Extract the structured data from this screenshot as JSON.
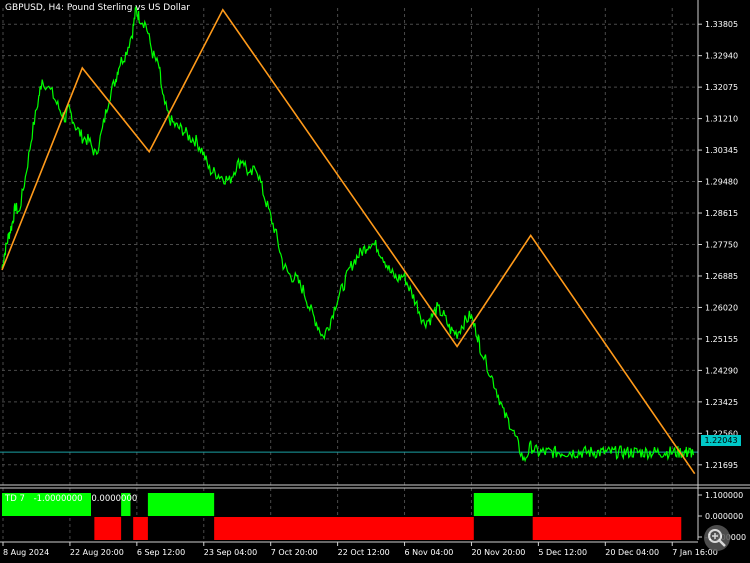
{
  "header": {
    "title": "GBPUSD, H4:  Pound Sterling vs US Dollar"
  },
  "current_price": "1.22043",
  "indicator": {
    "name": "TD 7",
    "value1": "-1.0000000",
    "value2": "0.0000000",
    "scale": [
      "1.100000",
      "0.000000",
      "-1.100000"
    ]
  },
  "colors": {
    "background": "#000000",
    "grid": "#4a4a4a",
    "price": "#00ff00",
    "zigzag": "#ff9a1a",
    "bid_line": "#1a9fa3",
    "bull": "#00ff00",
    "bear": "#ff0000"
  },
  "chart_data": {
    "type": "line",
    "symbol": "GBPUSD",
    "timeframe": "H4",
    "y_ticks": [
      "1.33805",
      "1.32940",
      "1.32075",
      "1.31210",
      "1.30345",
      "1.29480",
      "1.28615",
      "1.27750",
      "1.26885",
      "1.26020",
      "1.25155",
      "1.24290",
      "1.23425",
      "1.22560",
      "1.21695"
    ],
    "ylim": [
      1.2125,
      1.3425
    ],
    "x_ticks": [
      "8 Aug 2024",
      "22 Aug 20:00",
      "6 Sep 12:00",
      "23 Sep 04:00",
      "7 Oct 20:00",
      "22 Oct 12:00",
      "6 Nov 04:00",
      "20 Nov 20:00",
      "5 Dec 12:00",
      "20 Dec 04:00",
      "7 Jan 16:00"
    ],
    "price_series": {
      "name": "GBPUSD",
      "x": [
        0,
        0.05,
        0.1,
        0.15,
        0.2,
        0.25,
        0.35,
        0.45,
        0.55,
        0.6,
        0.75,
        0.85,
        0.95,
        1.0,
        1.1,
        1.2,
        1.3,
        1.4,
        1.5,
        1.6,
        1.7,
        1.75,
        1.85,
        1.95,
        2.0,
        2.05,
        2.15,
        2.25,
        2.35,
        2.4,
        2.5,
        2.6,
        2.7,
        2.8,
        2.9,
        3.0,
        3.1,
        3.2,
        3.3,
        3.4,
        3.5,
        3.6,
        3.7,
        3.8,
        3.9,
        4.0,
        4.1,
        4.2,
        4.3,
        4.4,
        4.5,
        4.6,
        4.7,
        4.8,
        4.9,
        5.0,
        5.1,
        5.2,
        5.3,
        5.4,
        5.5,
        5.6,
        5.7,
        5.8,
        5.9,
        6.0,
        6.1,
        6.2,
        6.3,
        6.4,
        6.5,
        6.6,
        6.7,
        6.8,
        6.9,
        7.0,
        7.1,
        7.15,
        7.3,
        7.4,
        7.5,
        7.6,
        7.7,
        7.8,
        7.9,
        8.0,
        8.1,
        8.2,
        8.3,
        8.4,
        8.5,
        8.6,
        8.7,
        8.8,
        8.9,
        9.0,
        9.1,
        9.2,
        9.3,
        9.4,
        9.5,
        9.6,
        9.7,
        9.8,
        9.9,
        10.0,
        10.1,
        10.2,
        10.25,
        10.3,
        10.4
      ],
      "values": [
        1.271,
        1.276,
        1.28,
        1.283,
        1.288,
        1.286,
        1.296,
        1.308,
        1.318,
        1.323,
        1.319,
        1.315,
        1.312,
        1.315,
        1.31,
        1.307,
        1.306,
        1.302,
        1.309,
        1.318,
        1.323,
        1.327,
        1.33,
        1.336,
        1.342,
        1.34,
        1.338,
        1.33,
        1.326,
        1.318,
        1.312,
        1.31,
        1.309,
        1.307,
        1.306,
        1.303,
        1.298,
        1.297,
        1.296,
        1.295,
        1.299,
        1.301,
        1.296,
        1.299,
        1.292,
        1.286,
        1.28,
        1.272,
        1.269,
        1.268,
        1.265,
        1.26,
        1.256,
        1.252,
        1.256,
        1.262,
        1.266,
        1.271,
        1.274,
        1.276,
        1.278,
        1.277,
        1.274,
        1.27,
        1.268,
        1.269,
        1.265,
        1.261,
        1.256,
        1.257,
        1.26,
        1.258,
        1.254,
        1.253,
        1.256,
        1.258,
        1.253,
        1.249,
        1.242,
        1.237,
        1.231,
        1.228,
        1.223,
        1.218,
        1.222,
        1.2204,
        1.2204,
        1.2204,
        1.2204,
        1.2204,
        1.2204,
        1.2204,
        1.2204,
        1.2204,
        1.2204,
        1.2204,
        1.2204,
        1.2204,
        1.2204,
        1.2204,
        1.2204,
        1.2204,
        1.2204,
        1.2204,
        1.2204,
        1.2204,
        1.2204,
        1.2204,
        1.2204,
        1.2204,
        1.2204
      ]
    },
    "zigzag": {
      "name": "ZigZag",
      "x": [
        0.0,
        1.2,
        2.2,
        3.3,
        6.8,
        7.9,
        10.35
      ],
      "values": [
        1.2705,
        1.326,
        1.303,
        1.342,
        1.2495,
        1.28,
        1.2145
      ]
    },
    "indicator_bars": {
      "segments": [
        {
          "from": 0.0,
          "to": 1.33,
          "state": 1
        },
        {
          "from": 1.38,
          "to": 1.78,
          "state": -1
        },
        {
          "from": 1.78,
          "to": 1.92,
          "state": 1
        },
        {
          "from": 1.96,
          "to": 2.18,
          "state": -1
        },
        {
          "from": 2.18,
          "to": 3.17,
          "state": 1
        },
        {
          "from": 3.17,
          "to": 7.05,
          "state": -1
        },
        {
          "from": 7.05,
          "to": 7.93,
          "state": 1
        },
        {
          "from": 7.93,
          "to": 10.15,
          "state": -1
        }
      ],
      "ylim": [
        -1.1,
        1.1
      ]
    }
  }
}
